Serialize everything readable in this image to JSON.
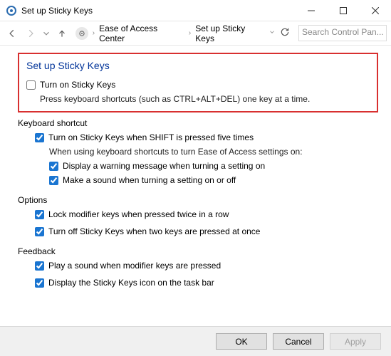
{
  "window": {
    "title": "Set up Sticky Keys"
  },
  "breadcrumb": {
    "level1": "Ease of Access Center",
    "level2": "Set up Sticky Keys"
  },
  "search": {
    "placeholder": "Search Control Pan..."
  },
  "main": {
    "heading": "Set up Sticky Keys",
    "enable_label": "Turn on Sticky Keys",
    "enable_desc": "Press keyboard shortcuts (such as CTRL+ALT+DEL) one key at a time."
  },
  "keyboard_section": {
    "title": "Keyboard shortcut",
    "shift5_label": "Turn on Sticky Keys when SHIFT is pressed five times",
    "subdesc": "When using keyboard shortcuts to turn Ease of Access settings on:",
    "warning_label": "Display a warning message when turning a setting on",
    "sound_label": "Make a sound when turning a setting on or off"
  },
  "options_section": {
    "title": "Options",
    "lock_label": "Lock modifier keys when pressed twice in a row",
    "turnoff_label": "Turn off Sticky Keys when two keys are pressed at once"
  },
  "feedback_section": {
    "title": "Feedback",
    "play_label": "Play a sound when modifier keys are pressed",
    "taskbar_label": "Display the Sticky Keys icon on the task bar"
  },
  "footer": {
    "ok": "OK",
    "cancel": "Cancel",
    "apply": "Apply"
  }
}
